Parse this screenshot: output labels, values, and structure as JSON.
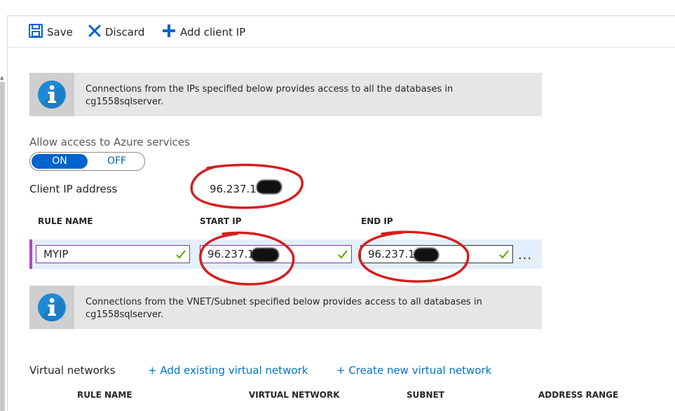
{
  "toolbar": {
    "save_label": "Save",
    "discard_label": "Discard",
    "add_client_ip_label": "Add client IP"
  },
  "info_boxes": [
    {
      "line1": "Connections from the IPs specified below provides access to all the databases in",
      "line2": "cg1558sqlserver."
    },
    {
      "line1": "Connections from the VNET/Subnet specified below provides access to all databases in",
      "line2": "cg1558sqlserver."
    }
  ],
  "azure_access": {
    "label": "Allow access to Azure services",
    "on_label": "ON",
    "off_label": "OFF",
    "state": "ON"
  },
  "client_ip": {
    "label": "Client IP address",
    "value": "96.237.10"
  },
  "firewall_table": {
    "headers": {
      "rule_name": "RULE NAME",
      "start_ip": "START IP",
      "end_ip": "END IP"
    },
    "rows": [
      {
        "rule_name": "MYIP",
        "start_ip": "96.237.10",
        "end_ip": "96.237.10"
      }
    ],
    "more_label": "..."
  },
  "virtual_networks": {
    "label": "Virtual networks",
    "add_existing_label": "+ Add existing virtual network",
    "create_new_label": "+ Create new virtual network",
    "headers": {
      "rule_name": "RULE NAME",
      "virtual_network": "VIRTUAL NETWORK",
      "subnet": "SUBNET",
      "address_range": "ADDRESS RANGE"
    }
  },
  "colors": {
    "accent_blue": "#0063ce",
    "link_blue": "#0072c6",
    "row_highlight": "#e3effa",
    "valid_check": "#57a300",
    "annotation_red": "#d41f1f"
  },
  "icons": [
    "save-icon",
    "close-icon",
    "plus-icon",
    "info-icon",
    "checkmark-icon"
  ]
}
